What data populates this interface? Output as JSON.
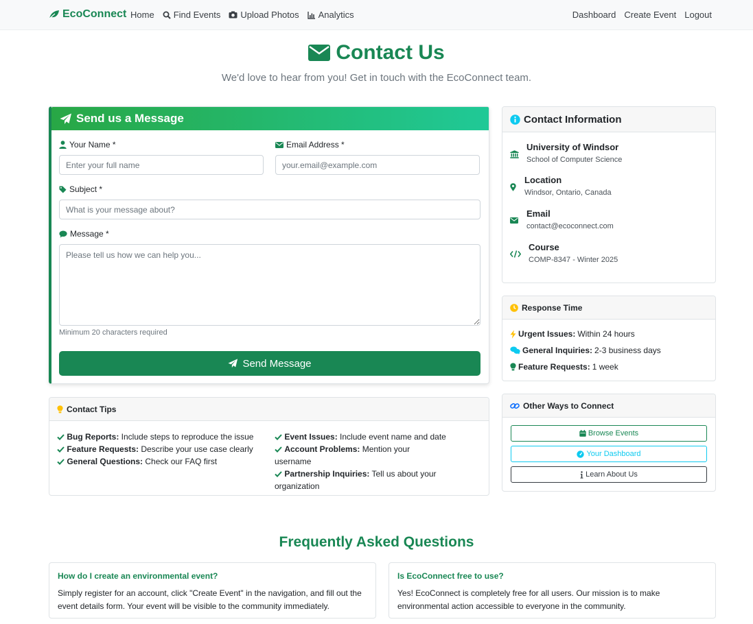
{
  "colors": {
    "brand": "#198754",
    "info": "#0dcaf0",
    "warning": "#ffc107",
    "link": "#0d6efd",
    "dark": "#343a40"
  },
  "navbar": {
    "brand": "EcoConnect",
    "brand_icon": "leaf-icon",
    "left": [
      {
        "label": "Home",
        "icon": ""
      },
      {
        "label": "Find Events",
        "icon": "search-icon"
      },
      {
        "label": "Upload Photos",
        "icon": "camera-icon"
      },
      {
        "label": "Analytics",
        "icon": "chart-icon"
      }
    ],
    "right": [
      {
        "label": "Dashboard"
      },
      {
        "label": "Create Event"
      },
      {
        "label": "Logout"
      }
    ]
  },
  "header": {
    "title": "Contact Us",
    "title_icon": "envelope-icon",
    "subtitle": "We'd love to hear from you! Get in touch with the EcoConnect team."
  },
  "form": {
    "title": "Send us a Message",
    "title_icon": "paper-plane-icon",
    "name_label": "Your Name *",
    "name_placeholder": "Enter your full name",
    "email_label": "Email Address *",
    "email_placeholder": "your.email@example.com",
    "subject_label": "Subject *",
    "subject_placeholder": "What is your message about?",
    "message_label": "Message *",
    "message_placeholder": "Please tell us how we can help you...",
    "message_help": "Minimum 20 characters required",
    "submit_label": "Send Message"
  },
  "tips": {
    "title": "Contact Tips",
    "title_icon": "lightbulb-icon",
    "left": [
      {
        "label": "Bug Reports:",
        "text": " Include steps to reproduce the issue"
      },
      {
        "label": "Feature Requests:",
        "text": " Describe your use case clearly"
      },
      {
        "label": "General Questions:",
        "text": " Check our FAQ first"
      }
    ],
    "right": [
      {
        "label": "Event Issues:",
        "text": " Include event name and date"
      },
      {
        "label": "Account Problems:",
        "text": " Mention your username"
      },
      {
        "label": "Partnership Inquiries:",
        "text": " Tell us about your organization"
      }
    ]
  },
  "contact_info": {
    "title": "Contact Information",
    "title_icon": "info-circle-icon",
    "items": [
      {
        "icon": "university-icon",
        "title": "University of Windsor",
        "detail": "School of Computer Science"
      },
      {
        "icon": "map-pin-icon",
        "title": "Location",
        "detail": "Windsor, Ontario, Canada"
      },
      {
        "icon": "envelope-icon",
        "title": "Email",
        "detail": "contact@ecoconnect.com"
      },
      {
        "icon": "code-icon",
        "title": "Course",
        "detail": "COMP-8347 - Winter 2025"
      }
    ]
  },
  "response_time": {
    "title": "Response Time",
    "title_icon": "clock-icon",
    "items": [
      {
        "icon": "bolt-icon",
        "label": "Urgent Issues:",
        "value": " Within 24 hours"
      },
      {
        "icon": "comments-icon",
        "label": "General Inquiries:",
        "value": " 2-3 business days"
      },
      {
        "icon": "lightbulb-icon",
        "label": "Feature Requests:",
        "value": " 1 week"
      }
    ]
  },
  "other_ways": {
    "title": "Other Ways to Connect",
    "title_icon": "link-icon",
    "buttons": [
      {
        "label": "Browse Events",
        "icon": "calendar-icon"
      },
      {
        "label": "Your Dashboard",
        "icon": "gauge-icon"
      },
      {
        "label": "Learn About Us",
        "icon": "info-icon"
      }
    ]
  },
  "faq": {
    "title": "Frequently Asked Questions",
    "items": [
      {
        "q": "How do I create an environmental event?",
        "a": "Simply register for an account, click \"Create Event\" in the navigation, and fill out the event details form. Your event will be visible to the community immediately."
      },
      {
        "q": "Is EcoConnect free to use?",
        "a": "Yes! EcoConnect is completely free for all users. Our mission is to make environmental action accessible to everyone in the community."
      }
    ]
  }
}
